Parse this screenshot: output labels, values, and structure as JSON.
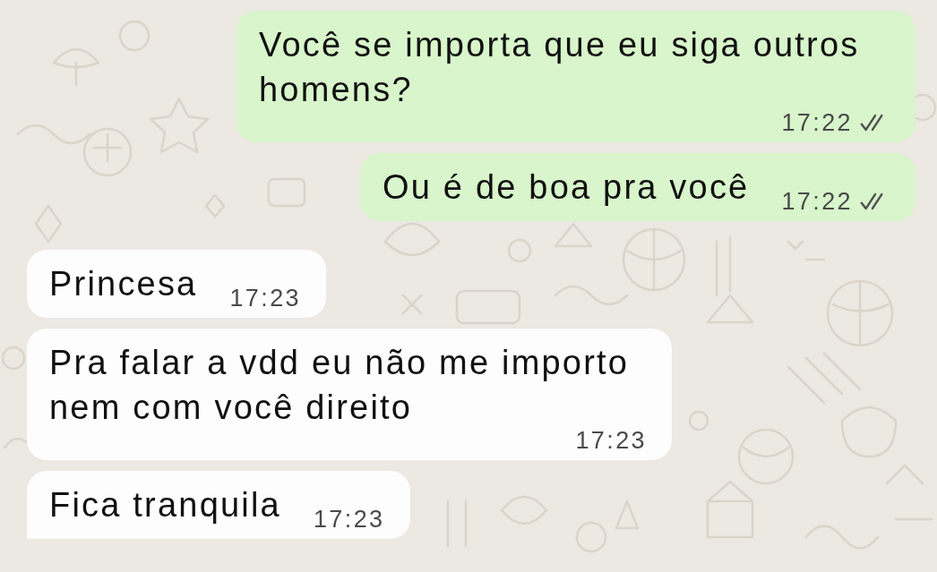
{
  "messages": [
    {
      "kind": "outgoing",
      "text": "Você se importa que eu siga outros homens?",
      "time": "17:22",
      "delivered": true,
      "read": false,
      "tail": false
    },
    {
      "kind": "outgoing",
      "text": "Ou é de boa pra você",
      "time": "17:22",
      "delivered": true,
      "read": false,
      "tail": false
    },
    {
      "kind": "incoming",
      "text": "Princesa",
      "time": "17:23",
      "tail": false
    },
    {
      "kind": "incoming",
      "text": "Pra falar a vdd eu não me importo nem com você direito",
      "time": "17:23",
      "tail": false
    },
    {
      "kind": "incoming",
      "text": "Fica tranquila",
      "time": "17:23",
      "tail": true
    }
  ]
}
